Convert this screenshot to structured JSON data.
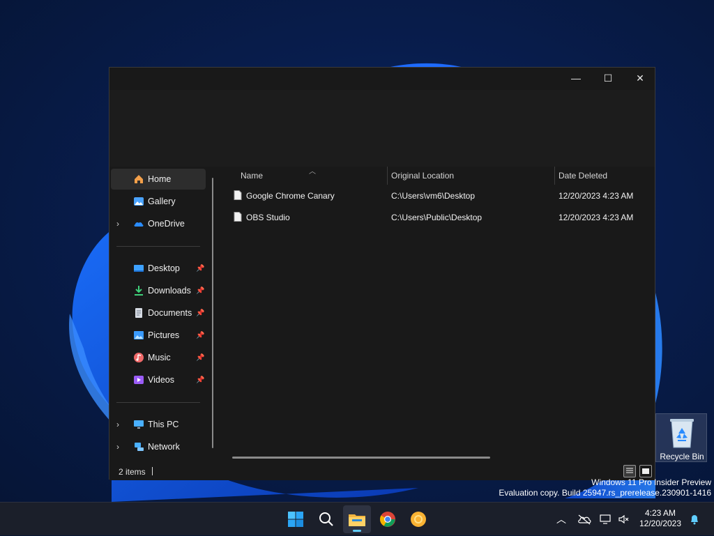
{
  "window": {
    "controls": {
      "minimize": "—",
      "maximize": "☐",
      "close": "✕"
    }
  },
  "nav": {
    "items": [
      {
        "label": "Home",
        "icon": "home-icon",
        "selected": true
      },
      {
        "label": "Gallery",
        "icon": "gallery-icon"
      },
      {
        "label": "OneDrive",
        "icon": "onedrive-icon",
        "expandable": true
      },
      {
        "label": "Desktop",
        "icon": "desktop-folder-icon",
        "pinned": true
      },
      {
        "label": "Downloads",
        "icon": "downloads-icon",
        "pinned": true
      },
      {
        "label": "Documents",
        "icon": "documents-icon",
        "pinned": true
      },
      {
        "label": "Pictures",
        "icon": "pictures-icon",
        "pinned": true
      },
      {
        "label": "Music",
        "icon": "music-icon",
        "pinned": true
      },
      {
        "label": "Videos",
        "icon": "videos-icon",
        "pinned": true
      },
      {
        "label": "This PC",
        "icon": "this-pc-icon",
        "expandable": true
      },
      {
        "label": "Network",
        "icon": "network-icon",
        "expandable": true
      }
    ]
  },
  "table": {
    "columns": [
      "Name",
      "Original Location",
      "Date Deleted"
    ],
    "rows": [
      {
        "name": "Google Chrome Canary",
        "location": "C:\\Users\\vm6\\Desktop",
        "date": "12/20/2023 4:23 AM"
      },
      {
        "name": "OBS Studio",
        "location": "C:\\Users\\Public\\Desktop",
        "date": "12/20/2023 4:23 AM"
      }
    ]
  },
  "status": {
    "count": "2 items"
  },
  "desktop": {
    "recycle_bin_label": "Recycle Bin",
    "watermark_line1": "Windows 11 Pro Insider Preview",
    "watermark_line2": "Evaluation copy. Build 25947.rs_prerelease.230901-1416"
  },
  "taskbar": {
    "apps": [
      "start-icon",
      "search-icon",
      "file-explorer-icon",
      "chrome-icon",
      "chrome-canary-icon"
    ],
    "active_app": "file-explorer-icon",
    "time": "4:23 AM",
    "date": "12/20/2023"
  },
  "colors": {
    "accent": "#60cdff",
    "window_bg": "#191919",
    "taskbar_bg": "#1b1f2a"
  }
}
